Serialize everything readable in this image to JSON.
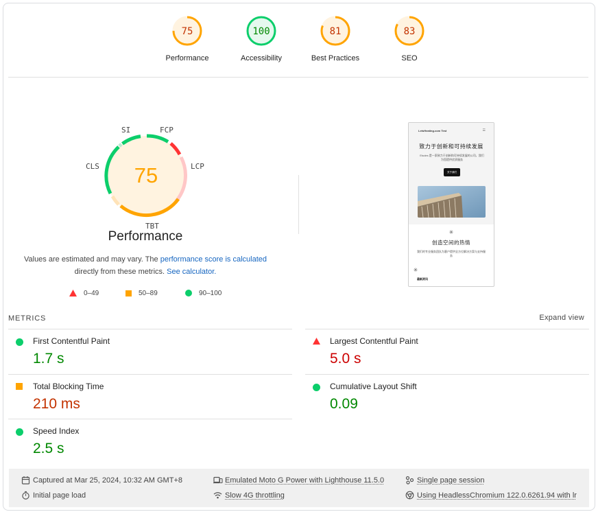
{
  "colors": {
    "pass": "#0cce6b",
    "average": "#ffa400",
    "fail": "#ff3333",
    "pass_text": "#008800",
    "average_text": "#c33300",
    "fail_text": "#cc0000"
  },
  "summary_gauges": [
    {
      "score": "75",
      "label": "Performance",
      "rating": "average"
    },
    {
      "score": "100",
      "label": "Accessibility",
      "rating": "pass"
    },
    {
      "score": "81",
      "label": "Best Practices",
      "rating": "average"
    },
    {
      "score": "83",
      "label": "SEO",
      "rating": "average"
    }
  ],
  "performance": {
    "score": "75",
    "title": "Performance",
    "tags": {
      "si": "SI",
      "fcp": "FCP",
      "lcp": "LCP",
      "tbt": "TBT",
      "cls": "CLS"
    },
    "note_before": "Values are estimated and may vary. The ",
    "note_link": "performance score is calculated",
    "note_middle": "directly from these metrics. ",
    "note_calc": "See calculator."
  },
  "legend": {
    "fail": "0–49",
    "average": "50–89",
    "pass": "90–100"
  },
  "screenshot": {
    "nav": "LetsHeating.com Test",
    "menu": "☰",
    "headline": "致力于创新和可持续发展",
    "subline": "Etudes 是一家致力于创新和可持续发展的公司，我们为您提供优质服务",
    "button": "关于我们",
    "star1": "✳",
    "heading2": "创造空间的热情",
    "para2": "我们的专业服务团队为客户提供全方位解决方案与支持服务",
    "star2": "✳",
    "small": "最新资讯"
  },
  "metrics": {
    "label": "METRICS",
    "expand": "Expand view",
    "items": [
      {
        "name": "First Contentful Paint",
        "value": "1.7 s",
        "rating": "pass"
      },
      {
        "name": "Largest Contentful Paint",
        "value": "5.0 s",
        "rating": "fail"
      },
      {
        "name": "Total Blocking Time",
        "value": "210 ms",
        "rating": "average"
      },
      {
        "name": "Cumulative Layout Shift",
        "value": "0.09",
        "rating": "pass"
      },
      {
        "name": "Speed Index",
        "value": "2.5 s",
        "rating": "pass"
      }
    ]
  },
  "footer": {
    "captured": "Captured at Mar 25, 2024, 10:32 AM GMT+8",
    "initial": "Initial page load",
    "device": "Emulated Moto G Power with Lighthouse 11.5.0",
    "throttling": "Slow 4G throttling",
    "session": "Single page session",
    "browser": "Using HeadlessChromium 122.0.6261.94 with lr"
  }
}
